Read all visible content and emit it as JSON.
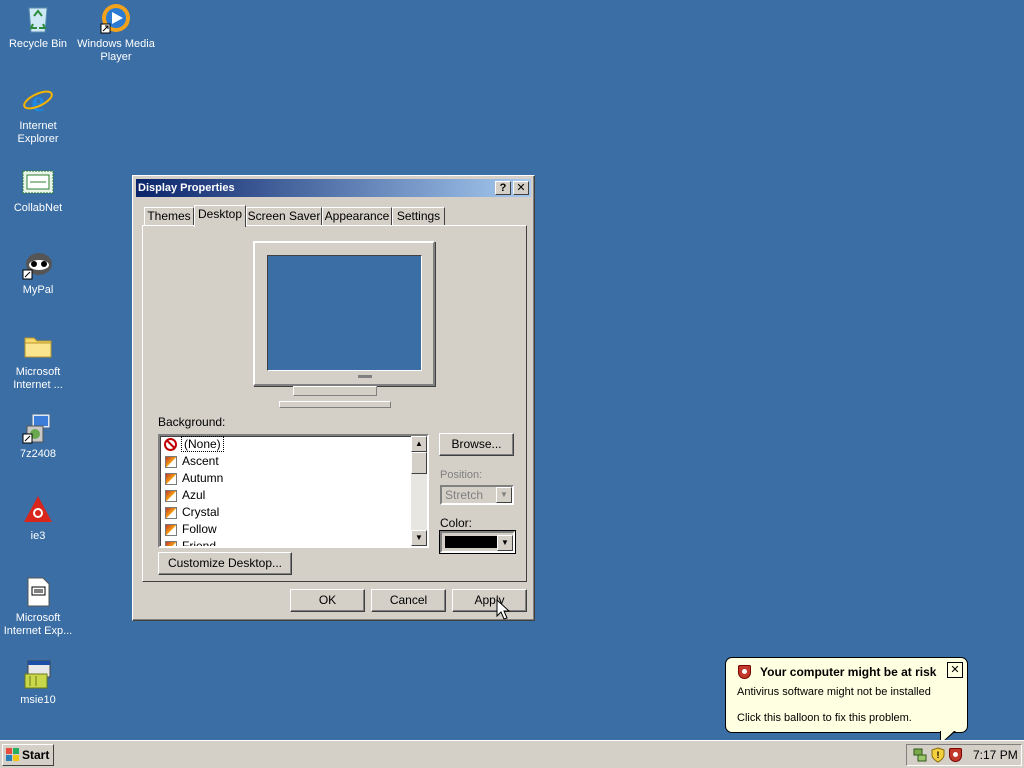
{
  "desktop": {
    "icons": [
      {
        "label": "Recycle Bin",
        "icon": "recycle-bin-icon"
      },
      {
        "label": "Windows Media Player",
        "icon": "media-player-icon"
      },
      {
        "label": "Internet Explorer",
        "icon": "ie-icon"
      },
      {
        "label": "CollabNet",
        "icon": "collabnet-icon"
      },
      {
        "label": "MyPal",
        "icon": "mypal-icon"
      },
      {
        "label": "Microsoft Internet ...",
        "icon": "folder-icon"
      },
      {
        "label": "7z2408",
        "icon": "installer-icon"
      },
      {
        "label": "ie3",
        "icon": "ie3-icon"
      },
      {
        "label": "Microsoft Internet Exp...",
        "icon": "document-icon"
      },
      {
        "label": "msie10",
        "icon": "setup-icon"
      }
    ]
  },
  "dialog": {
    "title": "Display Properties",
    "help_glyph": "?",
    "close_glyph": "✕",
    "tabs": [
      {
        "label": "Themes"
      },
      {
        "label": "Desktop",
        "active": true
      },
      {
        "label": "Screen Saver"
      },
      {
        "label": "Appearance"
      },
      {
        "label": "Settings"
      }
    ],
    "background_label": "Background:",
    "backgrounds": [
      "(None)",
      "Ascent",
      "Autumn",
      "Azul",
      "Crystal",
      "Follow",
      "Friend"
    ],
    "selected_background": "(None)",
    "browse_label": "Browse...",
    "position_label": "Position:",
    "position_value": "Stretch",
    "color_label": "Color:",
    "color_value": "#000000",
    "customize_label": "Customize Desktop...",
    "ok_label": "OK",
    "cancel_label": "Cancel",
    "apply_label": "Apply"
  },
  "balloon": {
    "title": "Your computer might be at risk",
    "line1": "Antivirus software might not be installed",
    "line2": "Click this balloon to fix this problem.",
    "close_glyph": "✕"
  },
  "taskbar": {
    "start_label": "Start",
    "clock": "7:17 PM"
  },
  "colors": {
    "desktop": "#3a6ea5",
    "face": "#d4d0c8",
    "title_start": "#0a246a",
    "title_end": "#a6caf0",
    "balloon": "#ffffe1"
  }
}
